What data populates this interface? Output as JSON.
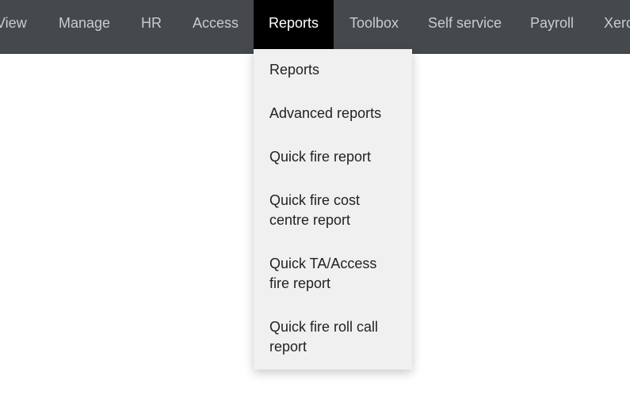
{
  "nav": {
    "items": [
      {
        "label": "View"
      },
      {
        "label": "Manage"
      },
      {
        "label": "HR"
      },
      {
        "label": "Access"
      },
      {
        "label": "Reports",
        "active": true
      },
      {
        "label": "Toolbox"
      },
      {
        "label": "Self service"
      },
      {
        "label": "Payroll"
      },
      {
        "label": "Xero"
      }
    ]
  },
  "reports_menu": {
    "items": [
      {
        "label": "Reports"
      },
      {
        "label": "Advanced reports"
      },
      {
        "label": "Quick fire report"
      },
      {
        "label": "Quick fire cost centre report"
      },
      {
        "label": "Quick TA/Access fire report"
      },
      {
        "label": "Quick fire roll call report"
      }
    ]
  },
  "colors": {
    "navbar_bg": "#45494d",
    "nav_text": "#c9cccf",
    "active_bg": "#000000",
    "active_text": "#ffffff",
    "dropdown_bg": "#f0f0f0",
    "dropdown_text": "#222222"
  }
}
